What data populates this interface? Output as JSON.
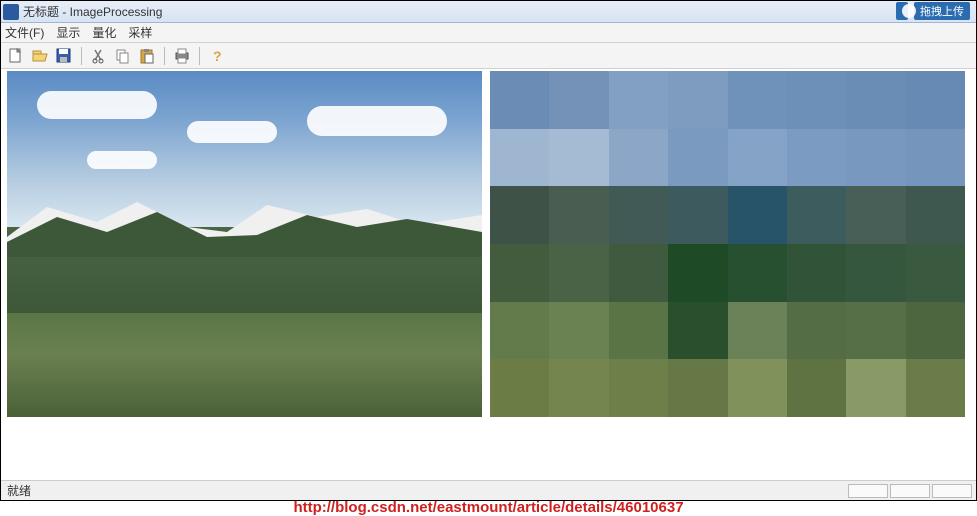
{
  "titlebar": {
    "title": "无标题 - ImageProcessing",
    "upload_label": "拖拽上传"
  },
  "menubar": {
    "file": "文件(F)",
    "display": "显示",
    "quantize": "量化",
    "sample": "采样"
  },
  "toolbar": {
    "icons": [
      "new-file-icon",
      "open-file-icon",
      "save-icon",
      "cut-icon",
      "copy-icon",
      "paste-icon",
      "print-icon",
      "help-icon"
    ]
  },
  "watermark": {
    "url": "http://blog.csdn.net/eastmount/article/details/46010637"
  },
  "statusbar": {
    "text": "就绪"
  },
  "pixel_colors": [
    "#6b8db5",
    "#7491b8",
    "#82a0c4",
    "#7d9cc0",
    "#6f92ba",
    "#6d90b9",
    "#6a8db6",
    "#678ab4",
    "#9fb6d1",
    "#a5bad3",
    "#8ba6c7",
    "#7a9ac0",
    "#85a3c7",
    "#7c9bc2",
    "#7998c0",
    "#7695bd",
    "#3e5247",
    "#4a5d51",
    "#425a56",
    "#3d5b5f",
    "#28546a",
    "#3c5c5e",
    "#475f57",
    "#3f584f",
    "#435c3e",
    "#4a6346",
    "#3f5a3e",
    "#1e4a26",
    "#265030",
    "#315439",
    "#35573d",
    "#3a5a40",
    "#637a4b",
    "#6a8152",
    "#5b7446",
    "#2a4f2c",
    "#6b8259",
    "#556d45",
    "#576f47",
    "#4e6640",
    "#6b7c44",
    "#748550",
    "#6e8049",
    "#657845",
    "#80915c",
    "#5f7242",
    "#889a65",
    "#6a7c48"
  ]
}
